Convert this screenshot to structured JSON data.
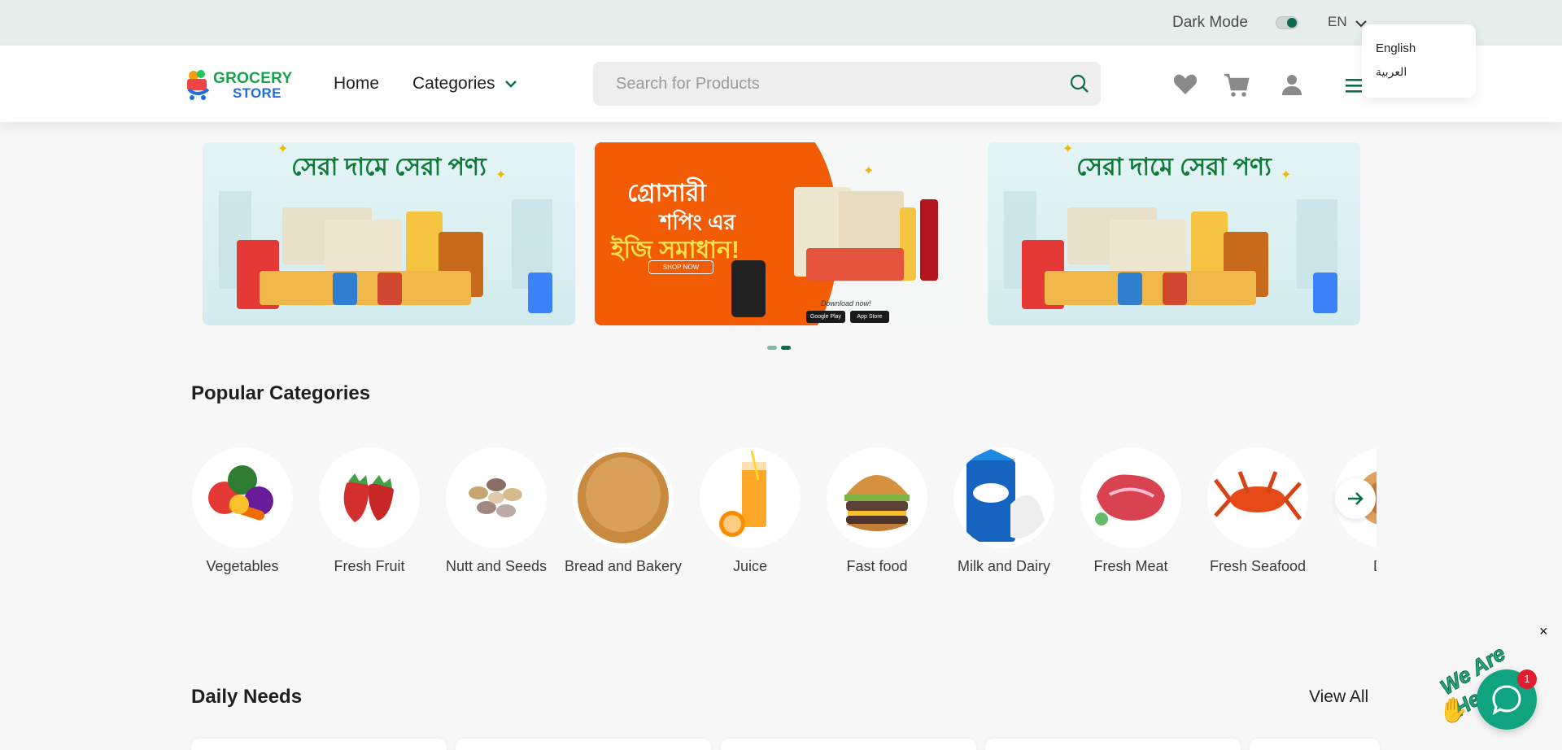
{
  "topbar": {
    "dark_mode_label": "Dark Mode",
    "dark_mode_on": true,
    "language_code": "EN"
  },
  "language_menu": {
    "options": [
      "English",
      "العربية"
    ]
  },
  "header": {
    "logo": {
      "line1": "GROCERY",
      "line2": "STORE"
    },
    "nav_home": "Home",
    "nav_categories": "Categories",
    "search_placeholder": "Search for Products",
    "icons": [
      "heart-icon",
      "cart-icon",
      "user-icon",
      "menu-icon"
    ]
  },
  "banners": [
    {
      "headline": "সেরা দামে সেরা পণ্য"
    },
    {
      "line1": "গ্রোসারী",
      "line2": "শপিং এর",
      "line3": "ইজি সমাধান!",
      "cta": "SHOP NOW",
      "download": "Download now!",
      "store1": "Google Play",
      "store2": "App Store"
    },
    {
      "headline": "সেরা দামে সেরা পণ্য"
    }
  ],
  "carousel": {
    "dots": 2,
    "active_dot": 2
  },
  "popular_categories": {
    "title": "Popular Categories",
    "items": [
      "Vegetables",
      "Fresh Fruit",
      "Nutt and Seeds",
      "Bread and Bakery",
      "Juice",
      "Fast food",
      "Milk and Dairy",
      "Fresh Meat",
      "Fresh Seafood",
      "Dry"
    ]
  },
  "daily_needs": {
    "title": "Daily Needs",
    "view_all": "View All"
  },
  "chat": {
    "tagline": "We Are Here!",
    "badge_count": "1",
    "close": "×"
  },
  "colors": {
    "primary": "#0b6b4f",
    "accent_orange": "#f25c05",
    "topbar_bg": "#e6eeec",
    "chat_green": "#10a37f"
  }
}
